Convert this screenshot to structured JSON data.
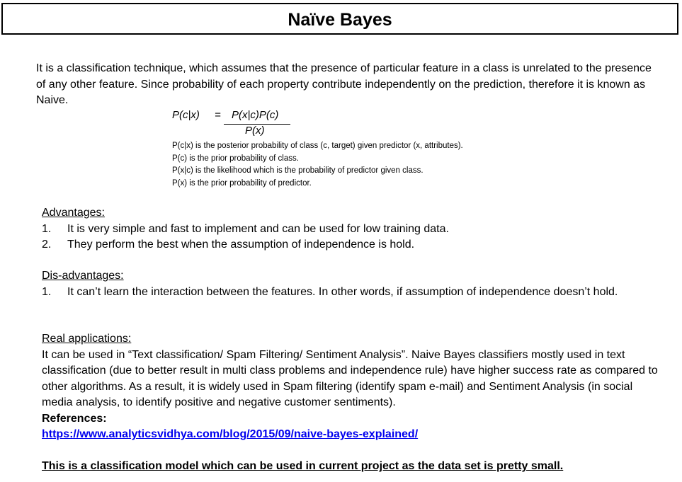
{
  "title": "Naïve Bayes",
  "intro": "It is a classification technique, which assumes that the presence of particular feature in a class is unrelated to the presence of any other feature. Since probability of each property contribute independently on the prediction, therefore it is known as Naive.",
  "formula": {
    "lhs": "P(c|x)",
    "eq": "=",
    "numerator": "P(x|c)P(c)",
    "denominator": "P(x)"
  },
  "definitions": [
    "P(c|x) is the posterior probability of class (c, target) given predictor (x, attributes).",
    "P(c) is the prior probability of class.",
    "P(x|c) is the likelihood which is the probability of predictor given class.",
    "P(x) is the prior probability of predictor."
  ],
  "advantages": {
    "heading": "Advantages:",
    "items": [
      {
        "num": "1.",
        "text": "It is very simple and fast to implement and can be used for low training data."
      },
      {
        "num": "2.",
        "text": "They perform the best when the assumption of independence is hold."
      }
    ]
  },
  "disadvantages": {
    "heading": "Dis-advantages:",
    "items": [
      {
        "num": "1.",
        "text": "It can’t learn the interaction between the features. In other words, if assumption of independence doesn’t hold."
      }
    ]
  },
  "applications": {
    "heading": "Real applications:",
    "text": "It can be used in “Text classification/ Spam Filtering/ Sentiment Analysis”. Naive Bayes classifiers mostly used in text classification (due to better result in multi class problems and independence rule) have higher success rate as compared to other algorithms. As a result, it is widely used in Spam filtering (identify spam e-mail) and Sentiment Analysis (in social media analysis, to identify positive and negative customer sentiments)."
  },
  "references": {
    "label": "References:",
    "link": "https://www.analyticsvidhya.com/blog/2015/09/naive-bayes-explained/"
  },
  "note": "This is a classification model which can be used in current project as the data set is pretty small."
}
